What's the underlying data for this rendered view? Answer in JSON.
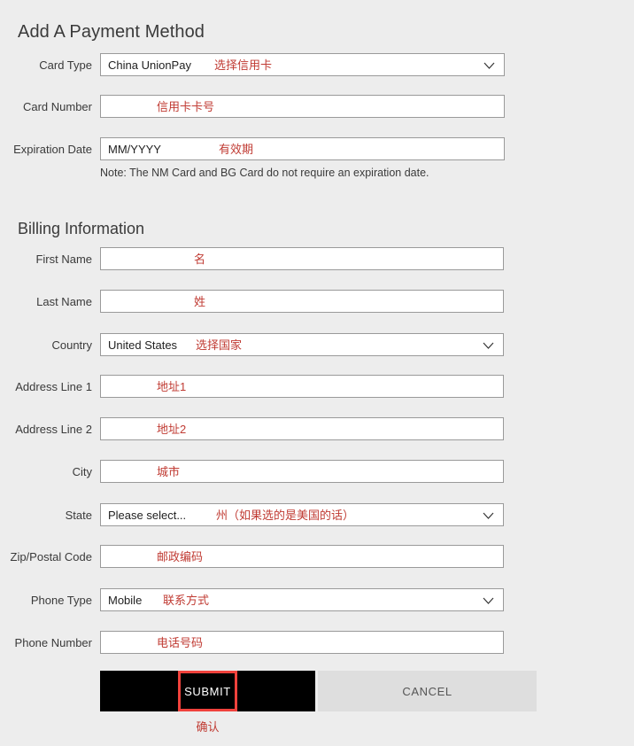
{
  "page": {
    "title": "Add A Payment Method",
    "section_title": "Billing Information",
    "hint": "Note: The NM Card and BG Card do not require an expiration date.",
    "accent_red": "#c03b33",
    "highlight_red": "#f0423c",
    "background": "#ededed"
  },
  "payment": {
    "card_type": {
      "label": "Card Type",
      "value": "China UnionPay",
      "annotation": "选择信用卡"
    },
    "card_number": {
      "label": "Card Number",
      "value": "",
      "annotation": "信用卡卡号"
    },
    "expiration_date": {
      "label": "Expiration Date",
      "value": "MM/YYYY",
      "annotation": "有效期"
    }
  },
  "billing": {
    "first_name": {
      "label": "First Name",
      "value": "",
      "annotation": "名"
    },
    "last_name": {
      "label": "Last Name",
      "value": "",
      "annotation": "姓"
    },
    "country": {
      "label": "Country",
      "value": "United States",
      "annotation": "选择国家"
    },
    "address_line_1": {
      "label": "Address Line 1",
      "value": "",
      "annotation": "地址1"
    },
    "address_line_2": {
      "label": "Address Line 2",
      "value": "",
      "annotation": "地址2"
    },
    "city": {
      "label": "City",
      "value": "",
      "annotation": "城市"
    },
    "state": {
      "label": "State",
      "value": "Please select...",
      "annotation": "州（如果选的是美国的话）"
    },
    "zip_postal_code": {
      "label": "Zip/Postal Code",
      "value": "",
      "annotation": "邮政编码"
    },
    "phone_type": {
      "label": "Phone Type",
      "value": "Mobile",
      "annotation": "联系方式"
    },
    "phone_number": {
      "label": "Phone Number",
      "value": "",
      "annotation": "电话号码"
    }
  },
  "actions": {
    "submit_label": "SUBMIT",
    "cancel_label": "CANCEL",
    "submit_annotation": "确认"
  },
  "icons": {
    "chevron": "chevron-down-icon"
  }
}
